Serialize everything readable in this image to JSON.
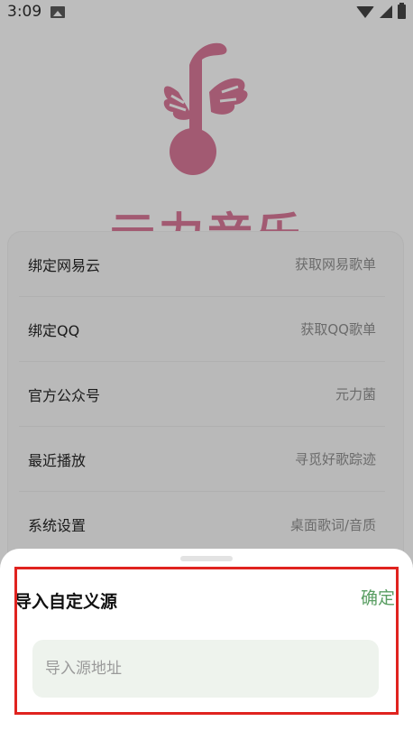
{
  "status_bar": {
    "time": "3:09",
    "icons": [
      "image-icon",
      "wifi-icon",
      "signal-icon",
      "battery-icon"
    ]
  },
  "logo": {
    "text": "元力音乐",
    "color": "#a25a72"
  },
  "menu": {
    "items": [
      {
        "label": "绑定网易云",
        "value": "获取网易歌单"
      },
      {
        "label": "绑定QQ",
        "value": "获取QQ歌单"
      },
      {
        "label": "官方公众号",
        "value": "元力菌"
      },
      {
        "label": "最近播放",
        "value": "寻觅好歌踪迹"
      },
      {
        "label": "系统设置",
        "value": "桌面歌词/音质"
      }
    ]
  },
  "sheet": {
    "title": "导入自定义源",
    "confirm_label": "确定",
    "input_placeholder": "导入源地址",
    "input_value": ""
  },
  "colors": {
    "accent_green": "#5a9e63",
    "highlight_red": "#e0231f",
    "input_bg": "#eef3ed"
  }
}
